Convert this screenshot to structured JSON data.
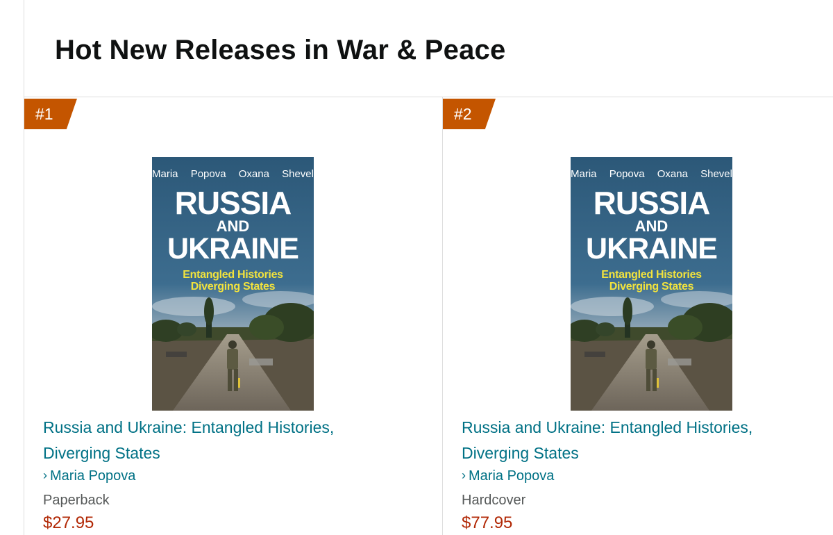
{
  "page": {
    "heading": "Hot New Releases in War & Peace"
  },
  "colors": {
    "rank_badge": "#c45500",
    "link": "#007185",
    "price": "#b12704",
    "format": "#565959",
    "cover_background": "#2d5a78",
    "cover_subtitle": "#f2e33d"
  },
  "products": [
    {
      "rank": "#1",
      "cover": {
        "authors": "Maria Popova Oxana Shevel",
        "title_line_1": "RUSSIA",
        "title_line_2": "AND",
        "title_line_3": "UKRAINE",
        "subtitle_line_1": "Entangled Histories",
        "subtitle_line_2": "Diverging States"
      },
      "title": "Russia and Ukraine: Entangled Histories, Diverging States",
      "author_chevron": "›",
      "author": "Maria Popova",
      "format": "Paperback",
      "price": "$27.95"
    },
    {
      "rank": "#2",
      "cover": {
        "authors": "Maria Popova Oxana Shevel",
        "title_line_1": "RUSSIA",
        "title_line_2": "AND",
        "title_line_3": "UKRAINE",
        "subtitle_line_1": "Entangled Histories",
        "subtitle_line_2": "Diverging States"
      },
      "title": "Russia and Ukraine: Entangled Histories, Diverging States",
      "author_chevron": "›",
      "author": "Maria Popova",
      "format": "Hardcover",
      "price": "$77.95"
    }
  ]
}
